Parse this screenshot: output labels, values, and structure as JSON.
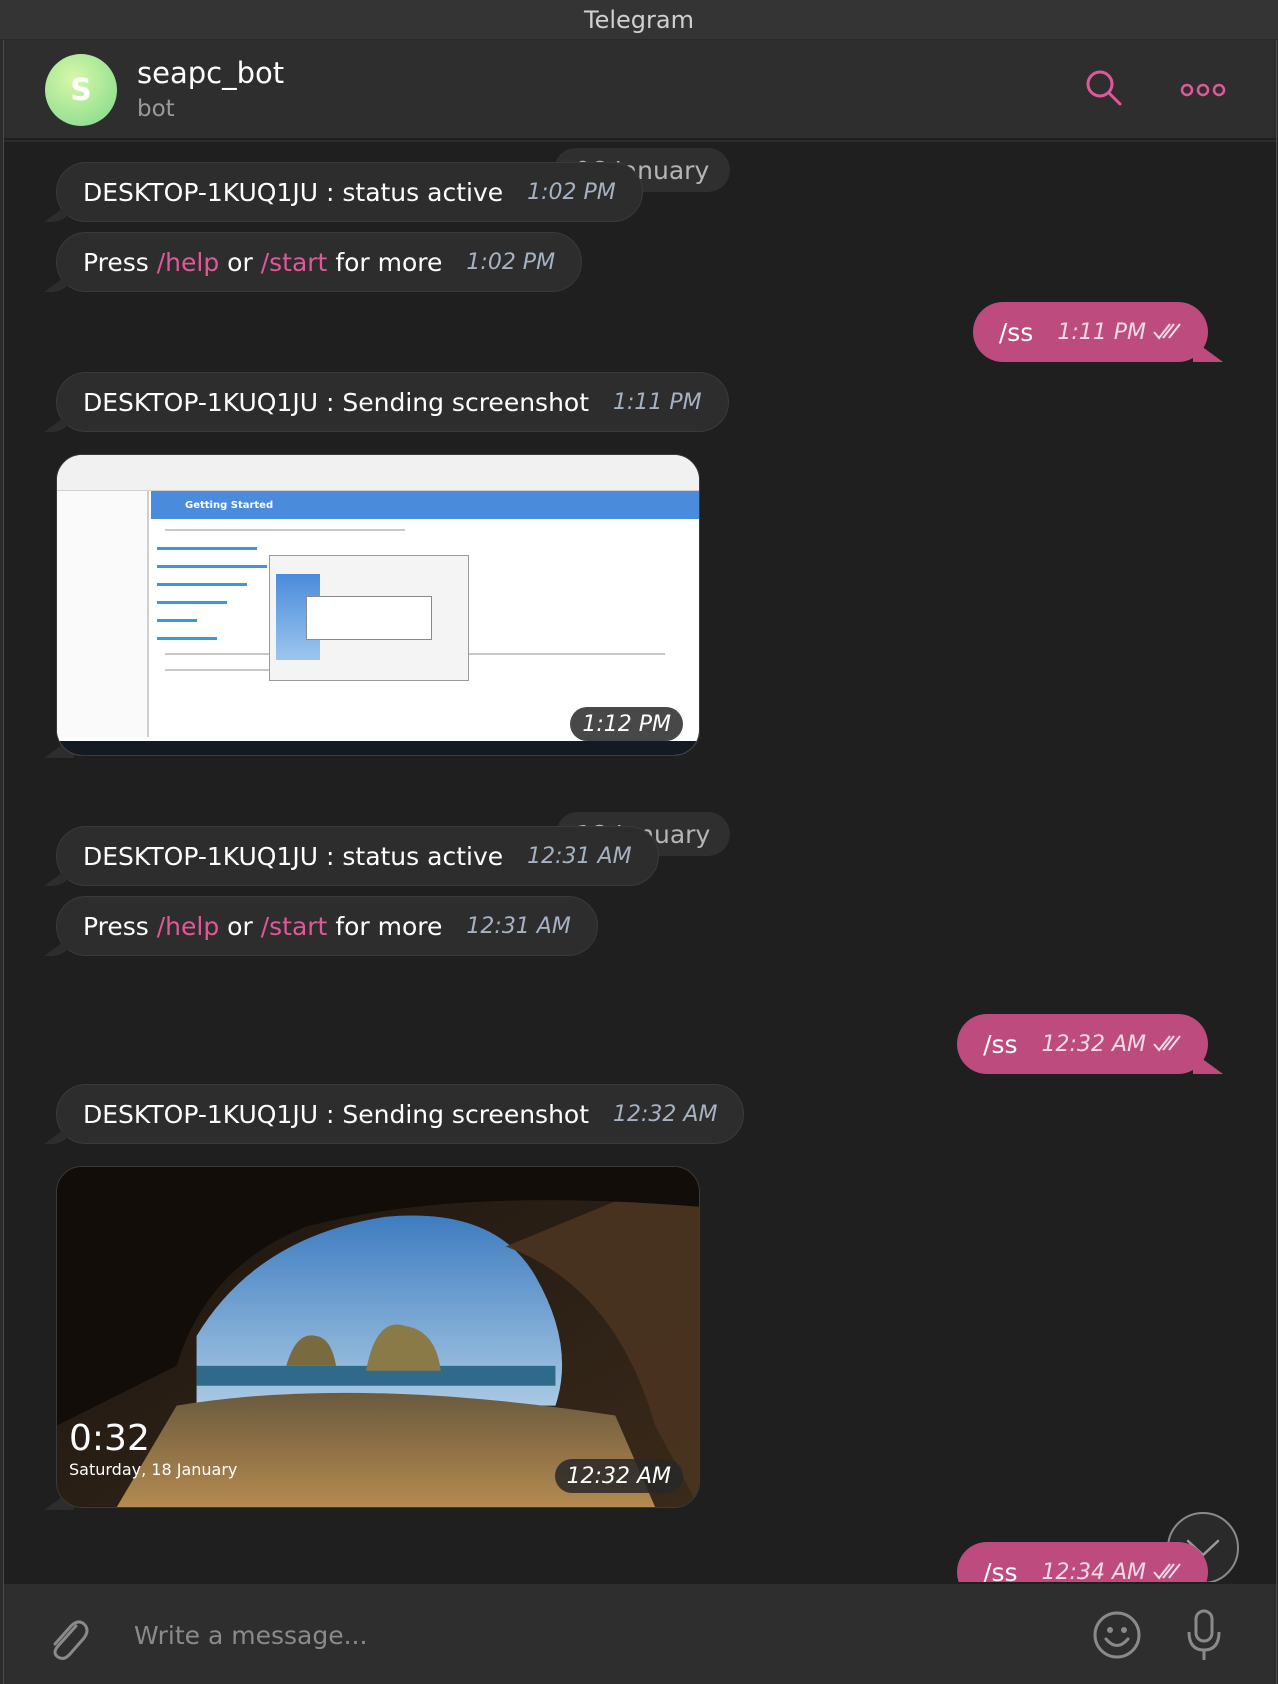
{
  "window": {
    "title": "Telegram"
  },
  "header": {
    "avatar_letter": "S",
    "name": "seapc_bot",
    "status": "bot",
    "search_icon": "search-icon",
    "more_icon": "more-icon"
  },
  "messages": {
    "date1": "06 January",
    "m1": {
      "text": "DESKTOP-1KUQ1JU : status active",
      "time": "1:02 PM"
    },
    "m2": {
      "pre": "Press ",
      "link1": "/help",
      "mid": " or ",
      "link2": "/start",
      "post": " for more",
      "time": "1:02 PM"
    },
    "m3": {
      "text": "/ss",
      "time": "1:11 PM"
    },
    "m4": {
      "text": "DESKTOP-1KUQ1JU : Sending screenshot",
      "time": "1:11 PM"
    },
    "photo1": {
      "time": "1:12 PM",
      "inner_heading": "Getting Started"
    },
    "date2": "18 January",
    "m5": {
      "text": "DESKTOP-1KUQ1JU : status active",
      "time": "12:31 AM"
    },
    "m6": {
      "pre": "Press ",
      "link1": "/help",
      "mid": " or ",
      "link2": "/start",
      "post": " for more",
      "time": "12:31 AM"
    },
    "m7": {
      "text": "/ss",
      "time": "12:32 AM"
    },
    "m8": {
      "text": "DESKTOP-1KUQ1JU : Sending screenshot",
      "time": "12:32 AM"
    },
    "photo2": {
      "time": "12:32 AM",
      "lock_time": "0:32",
      "lock_date": "Saturday, 18 January"
    },
    "m9": {
      "text": "/ss",
      "time": "12:34 AM"
    }
  },
  "composer": {
    "placeholder": "Write a message..."
  },
  "colors": {
    "accent": "#bd4b7e",
    "link": "#e0589a",
    "background": "#1f1f1f"
  }
}
